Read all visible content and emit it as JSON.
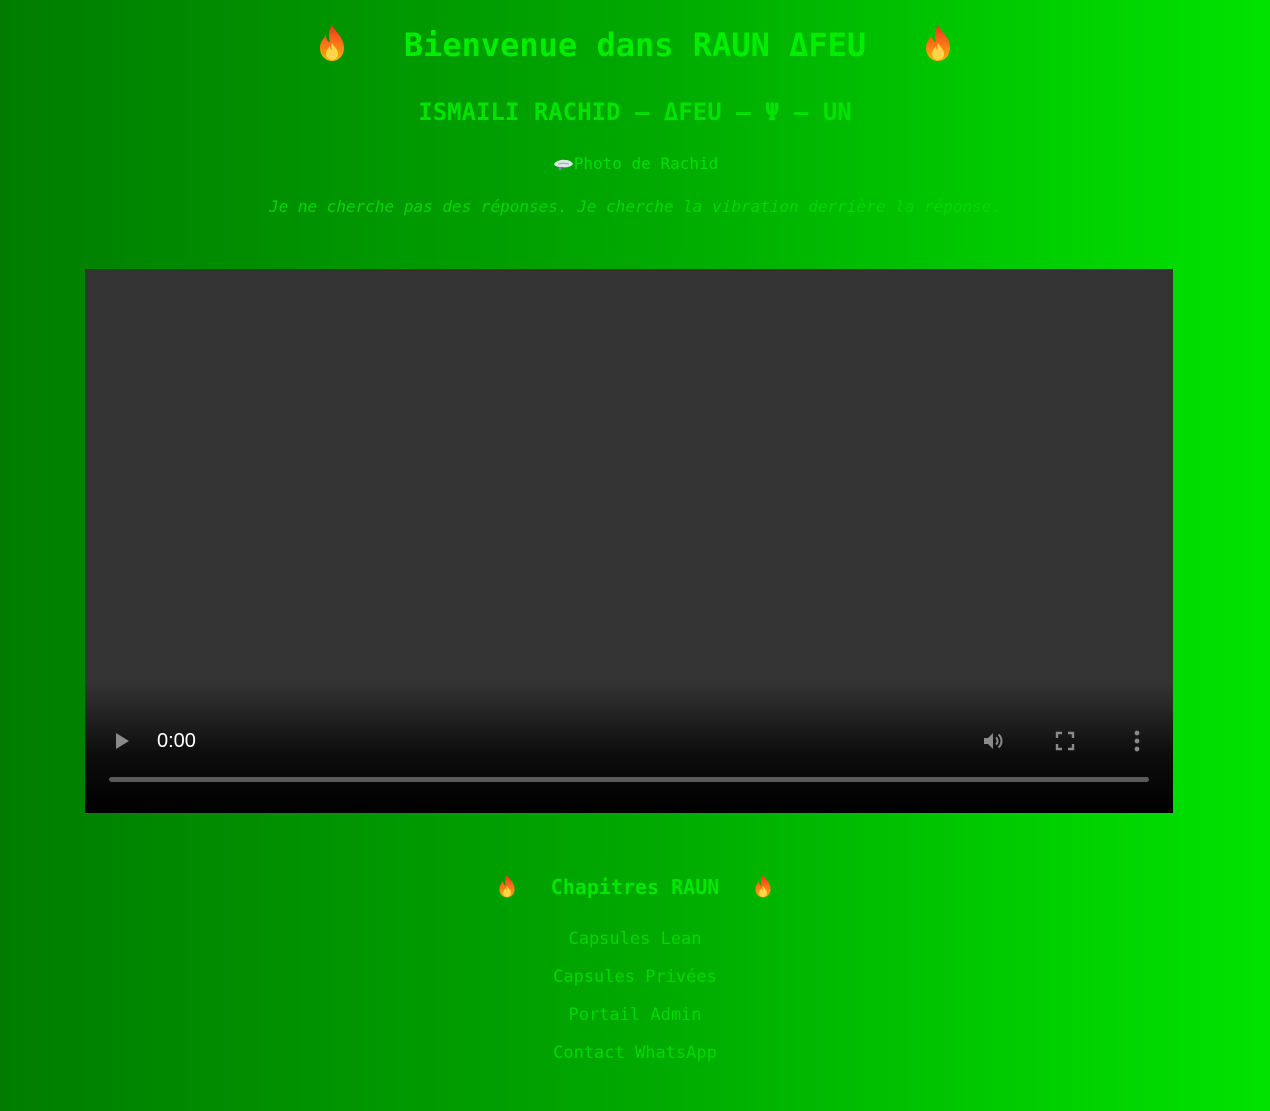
{
  "header": {
    "title": "Bienvenue dans RAUN ΔFEU",
    "subtitle": "ISMAILI RACHID – ΔFEU – Ψ – UN",
    "photo_alt": "Photo de Rachid",
    "tagline": "Je ne cherche pas des réponses. Je cherche la vibration derrière la réponse."
  },
  "video": {
    "time": "0:00",
    "progress": 0
  },
  "chapters": {
    "heading": "Chapitres RAUN",
    "links": [
      "Capsules Lean",
      "Capsules Privées",
      "Portail Admin",
      "Contact WhatsApp"
    ]
  },
  "icons": {
    "heading_icon": "flame-icon",
    "photo_icon": "broken-image-icon"
  },
  "colors": {
    "text": "#00ee00",
    "bg_left": "#007d00",
    "bg_right": "#00e300",
    "video_bg": "#333333"
  }
}
